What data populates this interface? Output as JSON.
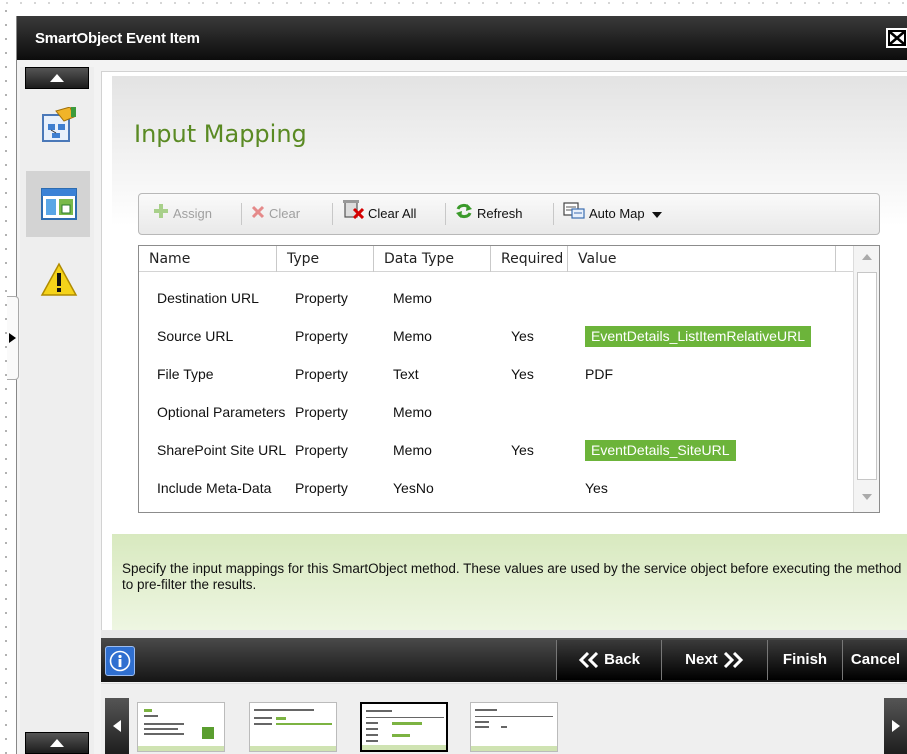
{
  "window": {
    "title": "SmartObject Event Item"
  },
  "page": {
    "heading": "Input Mapping"
  },
  "toolbar": {
    "assign": "Assign",
    "clear": "Clear",
    "clear_all": "Clear All",
    "refresh": "Refresh",
    "auto_map": "Auto Map"
  },
  "grid": {
    "columns": [
      "Name",
      "Type",
      "Data Type",
      "Required",
      "Value"
    ],
    "rows": [
      {
        "name": "Destination URL",
        "type": "Property",
        "data_type": "Memo",
        "required": "",
        "value": "",
        "value_kind": "text"
      },
      {
        "name": "Source URL",
        "type": "Property",
        "data_type": "Memo",
        "required": "Yes",
        "value": "EventDetails_ListItemRelativeURL",
        "value_kind": "mapped"
      },
      {
        "name": "File Type",
        "type": "Property",
        "data_type": "Text",
        "required": "Yes",
        "value": "PDF",
        "value_kind": "text"
      },
      {
        "name": "Optional Parameters",
        "type": "Property",
        "data_type": "Memo",
        "required": "",
        "value": "",
        "value_kind": "text"
      },
      {
        "name": "SharePoint Site URL",
        "type": "Property",
        "data_type": "Memo",
        "required": "Yes",
        "value": "EventDetails_SiteURL",
        "value_kind": "mapped"
      },
      {
        "name": "Include Meta-Data",
        "type": "Property",
        "data_type": "YesNo",
        "required": "",
        "value": "Yes",
        "value_kind": "text"
      }
    ]
  },
  "info": {
    "text": "Specify the input mappings for this SmartObject method. These values are used by the service object before executing the method to pre-filter the results."
  },
  "nav": {
    "back": "Back",
    "next": "Next",
    "finish": "Finish",
    "cancel": "Cancel"
  },
  "colors": {
    "heading": "#5a8a23",
    "mapped_chip": "#6cb43a",
    "info_box": "#d8e9bf",
    "titlebar": "#0c0c0c"
  },
  "icons": {
    "side": [
      "wizard-properties-icon",
      "window-layout-icon",
      "warning-icon"
    ]
  }
}
